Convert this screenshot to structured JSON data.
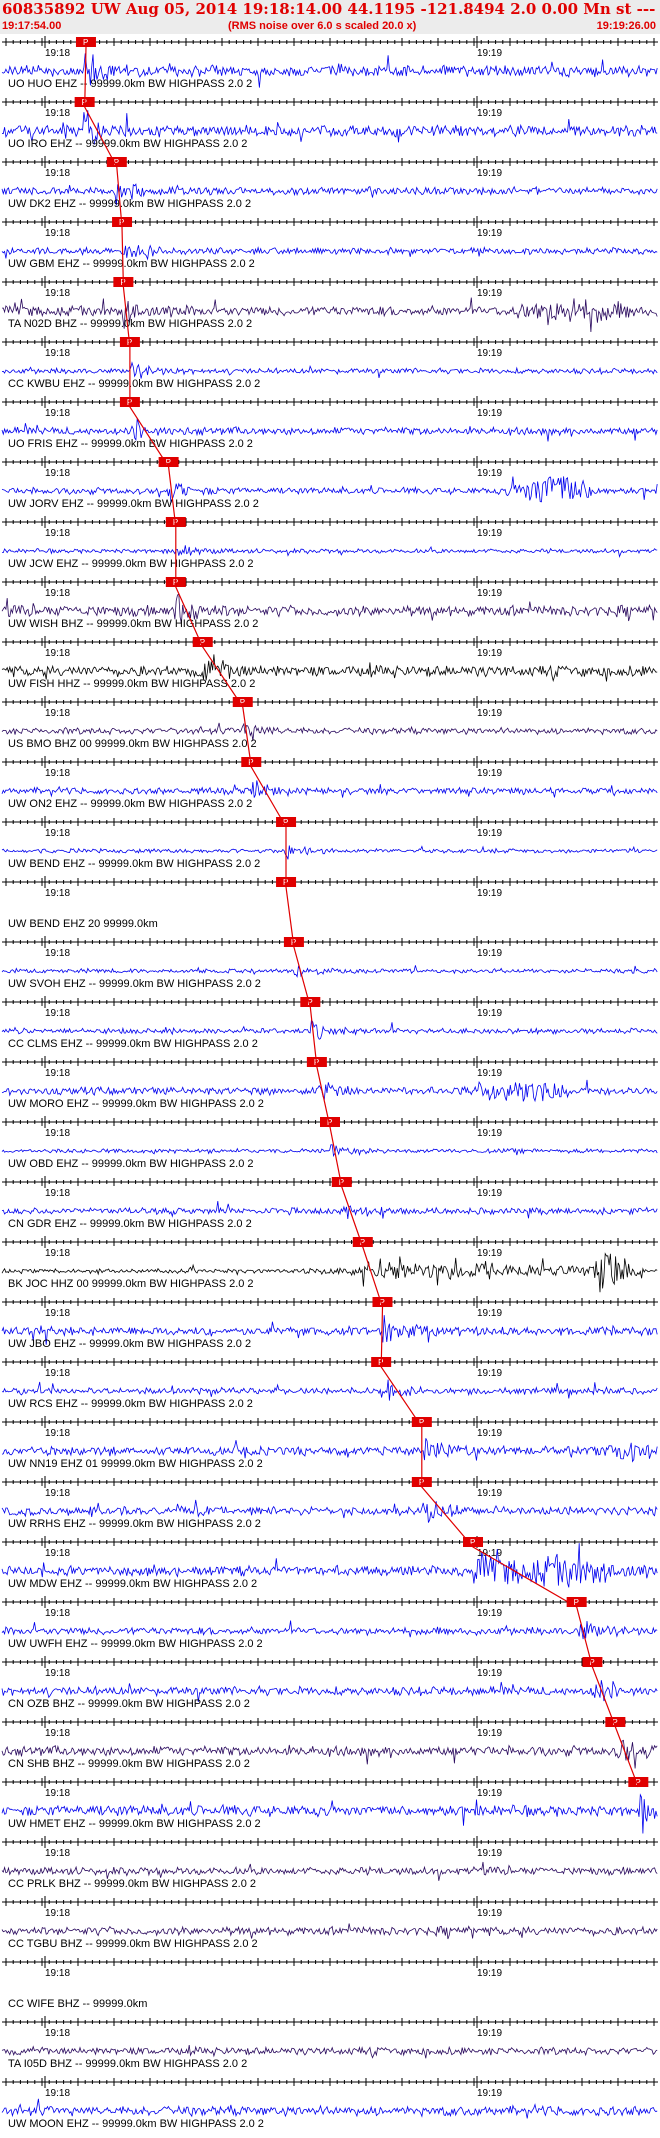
{
  "header": {
    "title": "60835892 UW Aug 05, 2014 19:18:14.00   44.1195 -121.8494  2.0 0.00 Mn st --- --- -- -1",
    "start_time": "19:17:54.00",
    "note": "(RMS noise over 6.0 s scaled 20.0 x)",
    "end_time": "19:19:26.00"
  },
  "colors": {
    "blue": "#0000ee",
    "dark": "#2a0a5e",
    "black": "#000000",
    "pick": "#e00000",
    "header_bg": "#ececec"
  },
  "chart_data": {
    "type": "seismogram",
    "minute_labels": [
      "19:18",
      "19:19"
    ],
    "pick_label": "P",
    "traces": [
      {
        "label": "UO HUO EHZ -- 99999.0km BW  HIGHPASS  2.0  2",
        "pick": 0.128,
        "color": "blue",
        "amp": 0.5,
        "bursts": []
      },
      {
        "label": "UO IRO EHZ -- 99999.0km BW  HIGHPASS  2.0  2",
        "pick": 0.126,
        "color": "blue",
        "amp": 0.5,
        "bursts": []
      },
      {
        "label": "UW DK2 EHZ -- 99999.0km BW  HIGHPASS  2.0  2",
        "pick": 0.175,
        "color": "blue",
        "amp": 0.35,
        "bursts": []
      },
      {
        "label": "UW GBM EHZ -- 99999.0km BW  HIGHPASS  2.0  2",
        "pick": 0.183,
        "color": "blue",
        "amp": 0.3,
        "bursts": []
      },
      {
        "label": "TA N02D BHZ -- 99999.0km BW  HIGHPASS  2.0  2",
        "pick": 0.185,
        "color": "dark",
        "amp": 0.45,
        "bursts": [
          [
            0.75,
            0.98,
            2.2
          ]
        ]
      },
      {
        "label": "CC KWBU EHZ -- 99999.0km BW  HIGHPASS  2.0  2",
        "pick": 0.195,
        "color": "blue",
        "amp": 0.25,
        "bursts": []
      },
      {
        "label": "UO FRIS EHZ -- 99999.0km BW  HIGHPASS  2.0  2",
        "pick": 0.195,
        "color": "blue",
        "amp": 0.35,
        "bursts": []
      },
      {
        "label": "UW JORV EHZ -- 99999.0km BW  HIGHPASS  2.0  2",
        "pick": 0.254,
        "color": "blue",
        "amp": 0.3,
        "bursts": [
          [
            0.76,
            0.92,
            6
          ]
        ]
      },
      {
        "label": "UW JCW EHZ -- 99999.0km BW  HIGHPASS  2.0  2",
        "pick": 0.265,
        "color": "blue",
        "amp": 0.2,
        "bursts": []
      },
      {
        "label": "UW WISH BHZ -- 99999.0km BW  HIGHPASS  2.0  2",
        "pick": 0.265,
        "color": "dark",
        "amp": 0.5,
        "bursts": []
      },
      {
        "label": "UW FISH HHZ -- 99999.0km BW  HIGHPASS  2.0  2",
        "pick": 0.306,
        "color": "black",
        "amp": 0.5,
        "bursts": []
      },
      {
        "label": "US BMO BHZ 00 99999.0km BW  HIGHPASS  2.0  2",
        "pick": 0.367,
        "color": "dark",
        "amp": 0.3,
        "bursts": []
      },
      {
        "label": "UW ON2 EHZ -- 99999.0km BW  HIGHPASS  2.0  2",
        "pick": 0.38,
        "color": "blue",
        "amp": 0.3,
        "bursts": []
      },
      {
        "label": "UW BEND EHZ -- 99999.0km BW  HIGHPASS  2.0  2",
        "pick": 0.433,
        "color": "blue",
        "amp": 0.2,
        "bursts": []
      },
      {
        "label": "UW BEND EHZ 20 99999.0km",
        "pick": 0.433,
        "color": "none",
        "amp": 0,
        "bursts": []
      },
      {
        "label": "UW SVOH EHZ -- 99999.0km BW  HIGHPASS  2.0  2",
        "pick": 0.445,
        "color": "blue",
        "amp": 0.2,
        "bursts": []
      },
      {
        "label": "CC CLMS EHZ -- 99999.0km BW  HIGHPASS  2.0  2",
        "pick": 0.47,
        "color": "blue",
        "amp": 0.25,
        "bursts": []
      },
      {
        "label": "UW MORO EHZ -- 99999.0km BW  HIGHPASS  2.0  2",
        "pick": 0.48,
        "color": "blue",
        "amp": 0.35,
        "bursts": [
          [
            0.7,
            0.88,
            3
          ]
        ]
      },
      {
        "label": "UW OBD EHZ -- 99999.0km BW  HIGHPASS  2.0  2",
        "pick": 0.5,
        "color": "blue",
        "amp": 0.2,
        "bursts": []
      },
      {
        "label": "CN GDR EHZ -- 99999.0km BW  HIGHPASS  2.0  2",
        "pick": 0.518,
        "color": "blue",
        "amp": 0.3,
        "bursts": []
      },
      {
        "label": "BK JOC HHZ 00 99999.0km BW  HIGHPASS  2.0  2",
        "pick": 0.55,
        "color": "black",
        "amp": 0.2,
        "bursts": [
          [
            0.43,
            1.0,
            3
          ],
          [
            0.88,
            0.98,
            5
          ]
        ]
      },
      {
        "label": "UW JBO EHZ -- 99999.0km BW  HIGHPASS  2.0  2",
        "pick": 0.58,
        "color": "blue",
        "amp": 0.4,
        "bursts": []
      },
      {
        "label": "UW RCS EHZ -- 99999.0km BW  HIGHPASS  2.0  2",
        "pick": 0.578,
        "color": "blue",
        "amp": 0.3,
        "bursts": []
      },
      {
        "label": "UW NN19 EHZ 01 99999.0km BW  HIGHPASS  2.0  2",
        "pick": 0.64,
        "color": "blue",
        "amp": 0.4,
        "bursts": [
          [
            0.9,
            1.0,
            2
          ]
        ]
      },
      {
        "label": "UW RRHS EHZ -- 99999.0km BW  HIGHPASS  2.0  2",
        "pick": 0.64,
        "color": "blue",
        "amp": 0.4,
        "bursts": []
      },
      {
        "label": "UW MDW EHZ -- 99999.0km BW  HIGHPASS  2.0  2",
        "pick": 0.718,
        "color": "blue",
        "amp": 0.45,
        "bursts": [
          [
            0.72,
            1.0,
            2.5
          ]
        ]
      },
      {
        "label": "UW UWFH EHZ -- 99999.0km BW  HIGHPASS  2.0  2",
        "pick": 0.876,
        "color": "blue",
        "amp": 0.35,
        "bursts": []
      },
      {
        "label": "CN OZB BHZ -- 99999.0km BW  HIGHPASS  2.0  2",
        "pick": 0.9,
        "color": "blue",
        "amp": 0.4,
        "bursts": []
      },
      {
        "label": "CN SHB BHZ -- 99999.0km BW  HIGHPASS  2.0  2",
        "pick": 0.935,
        "color": "dark",
        "amp": 0.45,
        "bursts": []
      },
      {
        "label": "UW HMET EHZ -- 99999.0km BW  HIGHPASS  2.0  2",
        "pick": 0.97,
        "color": "blue",
        "amp": 0.5,
        "bursts": []
      },
      {
        "label": "CC PRLK BHZ -- 99999.0km BW  HIGHPASS  2.0  2",
        "pick": null,
        "color": "dark",
        "amp": 0.35,
        "bursts": []
      },
      {
        "label": "CC TGBU BHZ -- 99999.0km BW  HIGHPASS  2.0  2",
        "pick": null,
        "color": "dark",
        "amp": 0.4,
        "bursts": []
      },
      {
        "label": "CC WIFE BHZ -- 99999.0km",
        "pick": null,
        "color": "none",
        "amp": 0,
        "bursts": []
      },
      {
        "label": "TA I05D BHZ -- 99999.0km BW  HIGHPASS  2.0  2",
        "pick": null,
        "color": "dark",
        "amp": 0.35,
        "bursts": []
      },
      {
        "label": "UW MOON EHZ -- 99999.0km BW  HIGHPASS  2.0  2",
        "pick": null,
        "color": "blue",
        "amp": 0.45,
        "bursts": []
      }
    ]
  }
}
